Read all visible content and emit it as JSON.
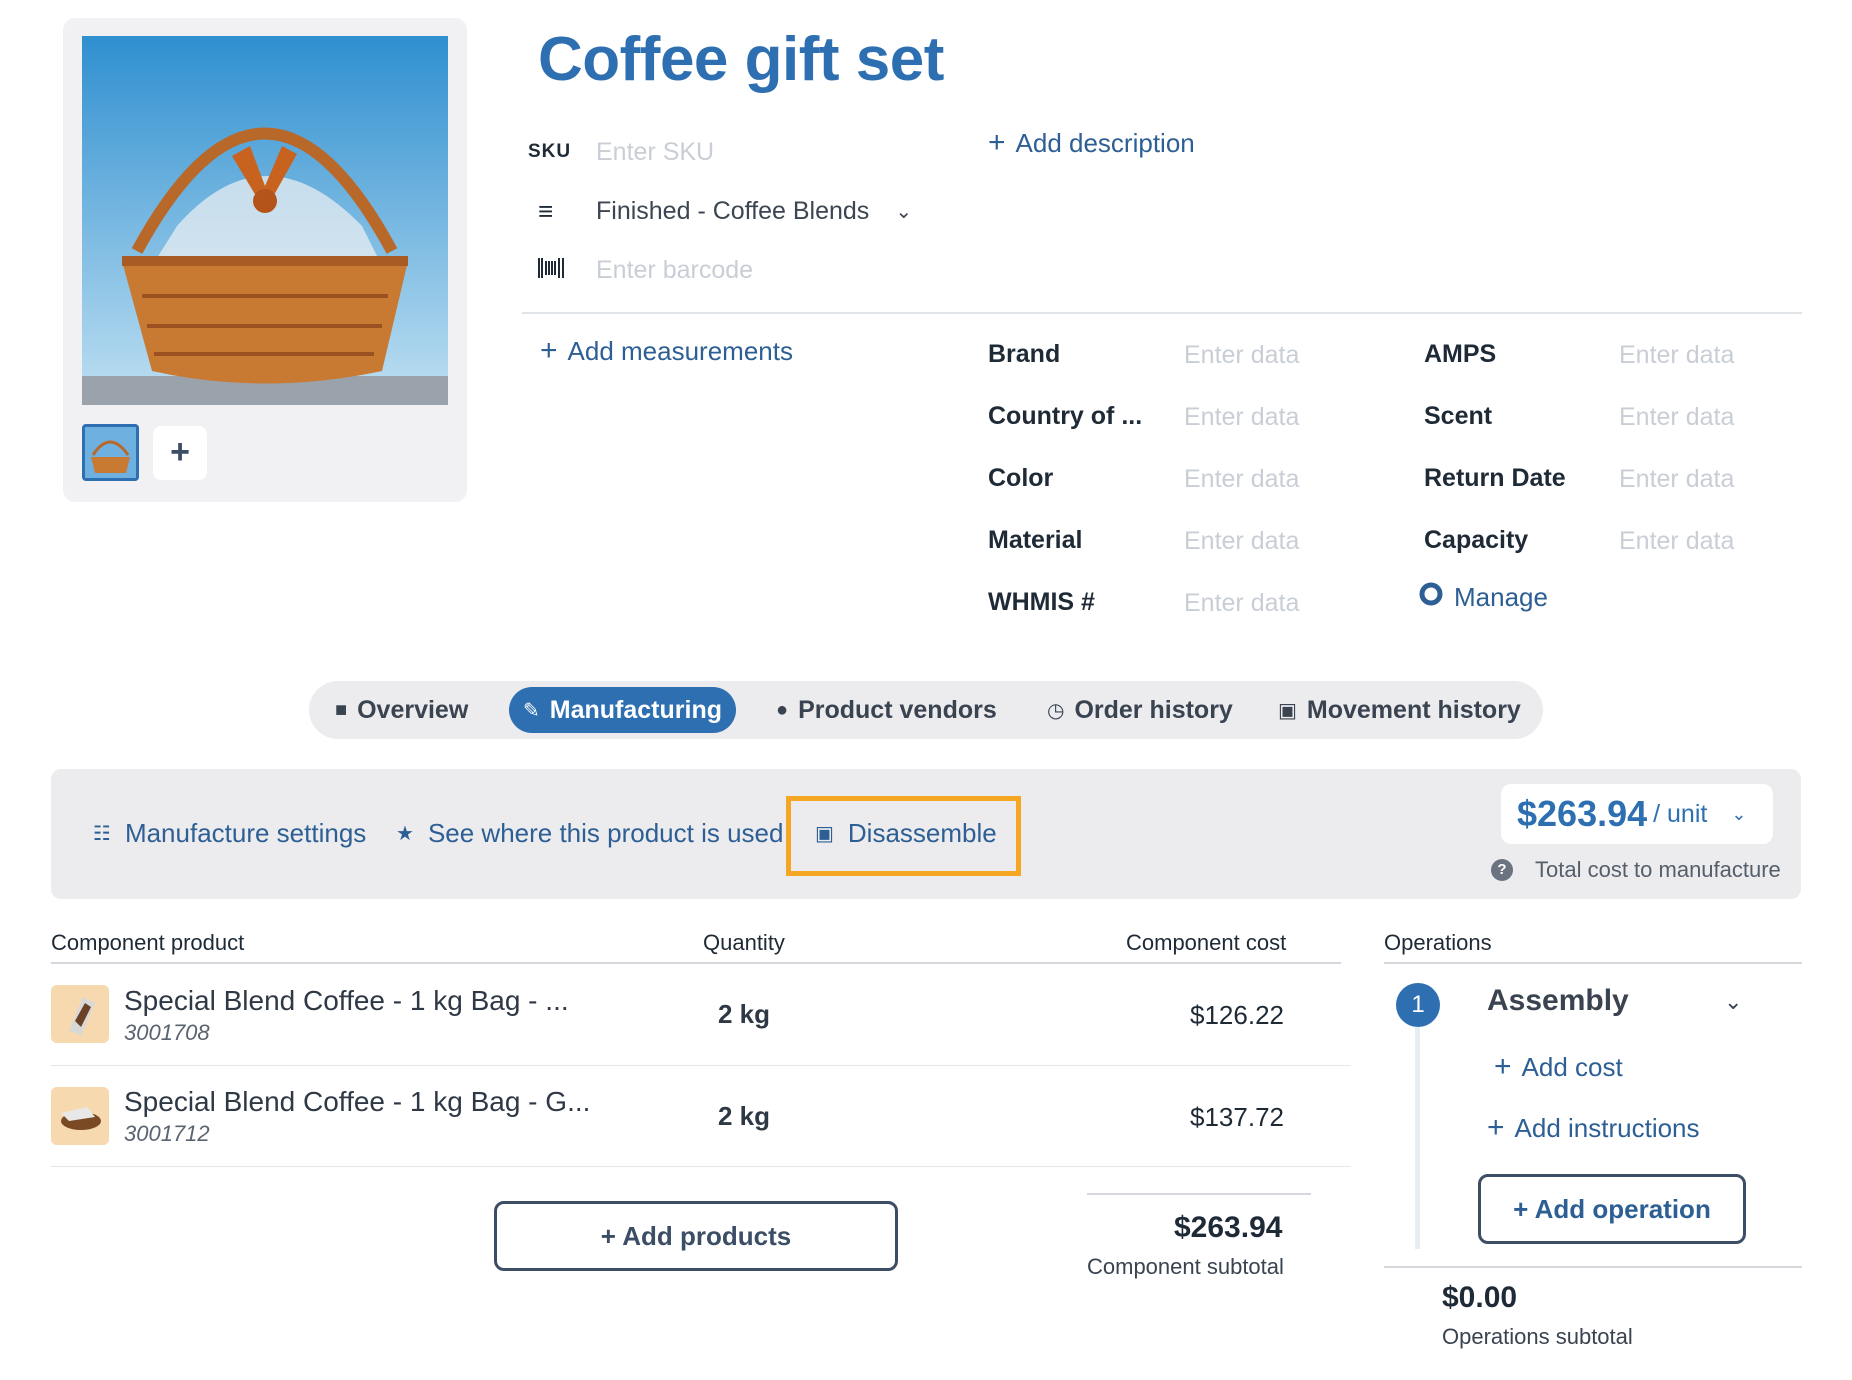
{
  "product": {
    "title": "Coffee gift set",
    "sku_label": "SKU",
    "sku_placeholder": "Enter SKU",
    "category": "Finished - Coffee Blends",
    "barcode_placeholder": "Enter barcode",
    "add_description": "Add description",
    "add_measurements": "Add measurements"
  },
  "attributes": [
    {
      "label": "Brand",
      "placeholder": "Enter data"
    },
    {
      "label": "Country of ...",
      "placeholder": "Enter data"
    },
    {
      "label": "Color",
      "placeholder": "Enter data"
    },
    {
      "label": "Material",
      "placeholder": "Enter data"
    },
    {
      "label": "WHMIS #",
      "placeholder": "Enter data"
    },
    {
      "label": "AMPS",
      "placeholder": "Enter data"
    },
    {
      "label": "Scent",
      "placeholder": "Enter data"
    },
    {
      "label": "Return Date",
      "placeholder": "Enter data"
    },
    {
      "label": "Capacity",
      "placeholder": "Enter data"
    }
  ],
  "manage_label": "Manage",
  "tabs": [
    {
      "label": "Overview",
      "icon": "folder-icon"
    },
    {
      "label": "Manufacturing",
      "icon": "edit-icon",
      "active": true
    },
    {
      "label": "Product vendors",
      "icon": "person-icon"
    },
    {
      "label": "Order history",
      "icon": "clock-icon"
    },
    {
      "label": "Movement history",
      "icon": "calendar-icon"
    }
  ],
  "actions": {
    "manufacture_settings": "Manufacture settings",
    "see_where_used": "See where this product is used",
    "disassemble": "Disassemble",
    "price": "$263.94",
    "price_unit": "/ unit",
    "total_cost_label": "Total cost to manufacture"
  },
  "components": {
    "headers": {
      "product": "Component product",
      "quantity": "Quantity",
      "cost": "Component cost",
      "operations": "Operations"
    },
    "rows": [
      {
        "name": "Special Blend Coffee - 1 kg Bag - ...",
        "sku": "3001708",
        "quantity": "2 kg",
        "cost": "$126.22"
      },
      {
        "name": "Special Blend Coffee - 1 kg Bag - G...",
        "sku": "3001712",
        "quantity": "2 kg",
        "cost": "$137.72"
      }
    ],
    "add_products": "+ Add products",
    "subtotal": "$263.94",
    "subtotal_label": "Component subtotal"
  },
  "operations": {
    "step_number": "1",
    "name": "Assembly",
    "add_cost": "Add cost",
    "add_instructions": "Add instructions",
    "add_operation": "+ Add operation",
    "subtotal": "$0.00",
    "subtotal_label": "Operations subtotal"
  },
  "colors": {
    "accent": "#2d6fb1",
    "link": "#2d5f94",
    "highlight": "#f5a623"
  }
}
